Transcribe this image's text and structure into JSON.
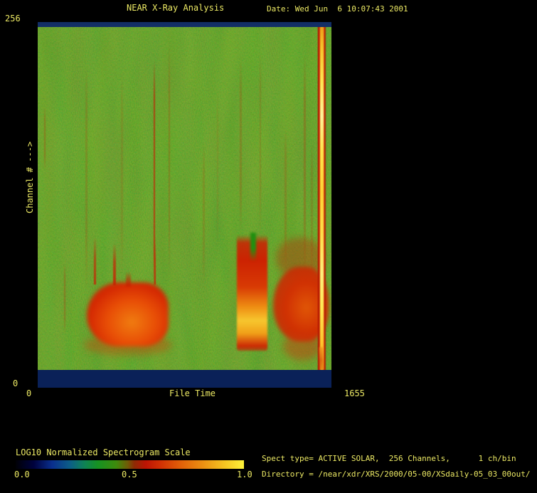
{
  "window": {
    "bg": "#000000",
    "text_color": "#ece964"
  },
  "header": {
    "title": "NEAR X-Ray Analysis",
    "date_label": "Date: Wed Jun  6 10:07:43 2001"
  },
  "plot": {
    "y_axis": {
      "top_label": "256",
      "bottom_label": "0",
      "axis_label": "Channel # --->"
    },
    "x_axis": {
      "left_label": "0",
      "center_label": "File Time",
      "right_label": "1655"
    }
  },
  "colorbar": {
    "title": "LOG10 Normalized Spectrogram Scale",
    "ticks": [
      "0.0",
      "0.5",
      "1.0"
    ],
    "gradient": [
      "#010106 0%",
      "#00023e 8%",
      "#0a2f8e 16%",
      "#0c5f86 24%",
      "#0e8256 30%",
      "#169222 36%",
      "#3d8c0c 44%",
      "#6f5c06 49%",
      "#8f2a04 52%",
      "#bc1404 57%",
      "#d02e04 63%",
      "#e05e08 72%",
      "#eb9012 82%",
      "#f6c822 92%",
      "#fdf23a 100%"
    ]
  },
  "info": {
    "spect_type": "Spect type= ACTIVE SOLAR,  256 Channels,      1 ch/bin",
    "directory": "Directory = /near/xdr/XRS/2000/05-00/XSdaily-05_03_00out/"
  },
  "chart_data": {
    "type": "heatmap",
    "title": "NEAR X-Ray Analysis",
    "xlabel": "File Time",
    "xlim": [
      0,
      1655
    ],
    "ylabel": "Channel #",
    "ylim": [
      0,
      256
    ],
    "scale": {
      "label": "LOG10 Normalized Spectrogram Scale",
      "range": [
        0.0,
        1.0
      ]
    },
    "background_level": 0.45,
    "features": [
      {
        "label": "quiet-background",
        "time_range": [
          0,
          1655
        ],
        "channel_range": [
          13,
          251
        ],
        "level": 0.45,
        "description": "mottled green background noise"
      },
      {
        "label": "top-band",
        "time_range": [
          0,
          1655
        ],
        "channel_range": [
          252,
          256
        ],
        "level": 0.05,
        "description": "dark navy band at top edge"
      },
      {
        "label": "bottom-band",
        "time_range": [
          0,
          1655
        ],
        "channel_range": [
          0,
          12
        ],
        "level": 0.05,
        "description": "dark navy band at bottom edge"
      },
      {
        "label": "solar-event-1",
        "time_range": [
          277,
          737
        ],
        "channel_range": [
          29,
          74
        ],
        "level": 0.72,
        "description": "broad red emission blob with orange core; narrow spikes reach channel ~106 at t=317, 429, 657"
      },
      {
        "label": "solar-event-2",
        "time_range": [
          1122,
          1294
        ],
        "channel_range": [
          26,
          107
        ],
        "level": 0.85,
        "description": "columnar red event with bright orange-yellow core at channels 29-54"
      },
      {
        "label": "solar-event-3",
        "time_range": [
          1326,
          1639
        ],
        "channel_range": [
          32,
          82
        ],
        "level": 0.7,
        "description": "red emission region merging into saturated column"
      },
      {
        "label": "saturated-column",
        "time_range": [
          1583,
          1627
        ],
        "channel_range": [
          0,
          250
        ],
        "level": 1.0,
        "description": "full-height saturated yellow stripe"
      },
      {
        "label": "faint-vertical-streaks",
        "times": [
          36,
          148,
          268,
          469,
          653,
          737,
          929,
          1010,
          1138,
          1250,
          1390,
          1498,
          1538
        ],
        "level": 0.55,
        "description": "thin reddish vertical streaks over background"
      }
    ],
    "render": [
      {
        "name": "streak",
        "style": {
          "left": "2.2%",
          "top": "23.2%",
          "width": "0.5%",
          "height": "17.5%",
          "opacity": "0.5",
          "background": "linear-gradient(to bottom, rgba(175,45,5,0) 0%, rgba(180,42,5,0.6) 20%, rgba(185,40,5,0.6) 75%, rgba(175,45,5,0) 100%)",
          "filter": "blur(0.6px)"
        }
      },
      {
        "name": "streak",
        "style": {
          "left": "9.0%",
          "top": "65.9%",
          "width": "0.5%",
          "height": "19.5%",
          "opacity": "0.5",
          "background": "linear-gradient(to bottom, rgba(175,45,5,0) 0%, rgba(180,42,5,0.6) 20%, rgba(185,40,5,0.6) 75%, rgba(175,45,5,0) 100%)",
          "filter": "blur(0.6px)"
        }
      },
      {
        "name": "streak",
        "style": {
          "left": "16.2%",
          "top": "11.5%",
          "width": "0.7%",
          "height": "62.3%",
          "opacity": "0.3",
          "background": "linear-gradient(to bottom, rgba(175,45,5,0) 0%, rgba(180,42,5,0.6) 20%, rgba(185,40,5,0.6) 75%, rgba(175,45,5,0) 100%)",
          "filter": "blur(0.6px)"
        }
      },
      {
        "name": "streak",
        "style": {
          "left": "28.3%",
          "top": "13.4%",
          "width": "0.7%",
          "height": "54.5%",
          "opacity": "0.22",
          "background": "linear-gradient(to bottom, rgba(175,45,5,0) 0%, rgba(180,42,5,0.6) 20%, rgba(185,40,5,0.6) 75%, rgba(175,45,5,0) 100%)",
          "filter": "blur(0.6px)"
        }
      },
      {
        "name": "streak",
        "style": {
          "left": "39.5%",
          "top": "10.5%",
          "width": "0.5%",
          "height": "66.1%",
          "opacity": "0.85",
          "background": "linear-gradient(to bottom, rgba(196,28,2,0) 0%, rgba(196,28,2,0.8) 15%, rgba(200,30,2,0.85) 80%, rgba(196,28,2,0) 100%)",
          "filter": "blur(0.5px)"
        }
      },
      {
        "name": "streak",
        "style": {
          "left": "44.6%",
          "top": "5.6%",
          "width": "0.5%",
          "height": "64.2%",
          "opacity": "0.42",
          "background": "linear-gradient(to bottom, rgba(175,45,5,0) 0%, rgba(180,42,5,0.6) 20%, rgba(185,40,5,0.6) 75%, rgba(175,45,5,0) 100%)",
          "filter": "blur(0.6px)"
        }
      },
      {
        "name": "streak",
        "style": {
          "left": "56.2%",
          "top": "32.9%",
          "width": "0.6%",
          "height": "38.9%",
          "opacity": "0.25",
          "background": "linear-gradient(to bottom, rgba(175,45,5,0) 0%, rgba(180,42,5,0.6) 20%, rgba(185,40,5,0.6) 75%, rgba(175,45,5,0) 100%)",
          "filter": "blur(0.6px)"
        }
      },
      {
        "name": "streak",
        "style": {
          "left": "61.0%",
          "top": "17.3%",
          "width": "0.6%",
          "height": "44.7%",
          "opacity": "0.18",
          "background": "linear-gradient(to bottom, rgba(175,45,5,0) 0%, rgba(180,42,5,0.6) 20%, rgba(185,40,5,0.6) 75%, rgba(175,45,5,0) 100%)",
          "filter": "blur(0.6px)"
        }
      },
      {
        "name": "streak",
        "style": {
          "left": "68.8%",
          "top": "9.5%",
          "width": "0.6%",
          "height": "48.6%",
          "opacity": "0.35",
          "background": "linear-gradient(to bottom, rgba(175,45,5,0) 0%, rgba(180,42,5,0.6) 20%, rgba(185,40,5,0.6) 75%, rgba(175,45,5,0) 100%)",
          "filter": "blur(0.6px)"
        }
      },
      {
        "name": "streak",
        "style": {
          "left": "75.5%",
          "top": "7.6%",
          "width": "0.6%",
          "height": "50.6%",
          "opacity": "0.3",
          "background": "linear-gradient(to bottom, rgba(175,45,5,0) 0%, rgba(180,42,5,0.6) 20%, rgba(185,40,5,0.6) 75%, rgba(175,45,5,0) 100%)",
          "filter": "blur(0.6px)"
        }
      },
      {
        "name": "streak",
        "style": {
          "left": "84.0%",
          "top": "29.0%",
          "width": "0.7%",
          "height": "38.9%",
          "opacity": "0.3",
          "background": "linear-gradient(to bottom, rgba(175,45,5,0) 0%, rgba(180,42,5,0.6) 20%, rgba(185,40,5,0.6) 75%, rgba(175,45,5,0) 100%)",
          "filter": "blur(0.6px)"
        }
      },
      {
        "name": "streak",
        "style": {
          "left": "90.6%",
          "top": "8.6%",
          "width": "0.6%",
          "height": "60.3%",
          "opacity": "0.45",
          "background": "linear-gradient(to bottom, rgba(175,45,5,0) 0%, rgba(180,42,5,0.6) 20%, rgba(185,40,5,0.6) 75%, rgba(175,45,5,0) 100%)",
          "filter": "blur(0.6px)"
        }
      },
      {
        "name": "streak",
        "style": {
          "left": "93.0%",
          "top": "32.9%",
          "width": "0.6%",
          "height": "37.0%",
          "opacity": "0.3",
          "background": "linear-gradient(to bottom, rgba(175,45,5,0) 0%, rgba(180,42,5,0.6) 20%, rgba(185,40,5,0.6) 75%, rgba(175,45,5,0) 100%)",
          "filter": "blur(0.6px)"
        }
      },
      {
        "name": "event1-fringe",
        "style": {
          "left": "15.7%",
          "top": "85.4%",
          "width": "30%",
          "height": "5.8%",
          "background": "rgba(195,75,12,0.45)",
          "borderRadius": "50%",
          "filter": "blur(5px)"
        }
      },
      {
        "name": "event1-blob",
        "style": {
          "left": "16.7%",
          "top": "71.2%",
          "width": "27.8%",
          "height": "17.5%",
          "background": "radial-gradient(ellipse at 55% 62%, #f07c10 0%, #e84e06 38%, #d42802 68%, rgba(195,42,4,0.85) 86%, rgba(165,60,10,0) 100%)",
          "borderRadius": "45% 35% 35% 45% / 60% 45% 40% 55%",
          "filter": "blur(3px)"
        }
      },
      {
        "name": "event1-spike",
        "style": {
          "left": "19.1%",
          "top": "58.8%",
          "width": "0.7%",
          "height": "13%",
          "opacity": "0.85",
          "background": "linear-gradient(to top, rgba(200,34,2,0.95) 0%, rgba(198,36,4,0.75) 55%, rgba(190,45,8,0) 100%)",
          "filter": "blur(0.5px)"
        }
      },
      {
        "name": "event1-spike",
        "style": {
          "left": "25.7%",
          "top": "60.5%",
          "width": "1.0%",
          "height": "11.5%",
          "opacity": "0.9",
          "background": "linear-gradient(to top, rgba(200,34,2,0.95) 0%, rgba(198,36,4,0.75) 55%, rgba(190,45,8,0) 100%)",
          "filter": "blur(0.5px)"
        }
      },
      {
        "name": "event1-spike",
        "style": {
          "left": "30.0%",
          "top": "68.3%",
          "width": "1.7%",
          "height": "4.0%",
          "opacity": "0.8",
          "background": "linear-gradient(to top, rgba(200,34,2,0.95) 0%, rgba(198,36,4,0.7) 55%, rgba(190,45,8,0) 100%)",
          "filter": "blur(1px)"
        }
      },
      {
        "name": "event1-spike",
        "style": {
          "left": "39.6%",
          "top": "58.8%",
          "width": "0.7%",
          "height": "13%",
          "opacity": "0.9",
          "background": "linear-gradient(to top, rgba(200,34,2,0.95) 0%, rgba(198,36,4,0.75) 55%, rgba(190,45,8,0) 100%)",
          "filter": "blur(0.5px)"
        }
      },
      {
        "name": "event2-column",
        "style": {
          "left": "67.8%",
          "top": "58.2%",
          "width": "10.4%",
          "height": "31.7%",
          "background": "linear-gradient(to bottom, rgba(204,32,2,0) 0%, rgba(204,32,2,0.85) 7%, #cc2202 22%, #d83a04 45%, #ee8c12 62%, #f7c62e 74%, #f0a018 85%, #cc2a04 96%, rgba(190,40,6,0.6) 100%)",
          "borderRadius": "3px",
          "filter": "blur(1.2px)"
        }
      },
      {
        "name": "event2-notch",
        "style": {
          "left": "72.3%",
          "top": "57.5%",
          "width": "2.0%",
          "height": "7.8%",
          "background": "linear-gradient(to bottom, #218f10 55%, rgba(33,143,16,0) 100%)",
          "filter": "blur(1.5px)"
        }
      },
      {
        "name": "event3-upper",
        "style": {
          "left": "81.0%",
          "top": "59.0%",
          "width": "16.5%",
          "height": "11.0%",
          "background": "rgba(185,42,6,0.4)",
          "borderRadius": "50%",
          "filter": "blur(5px)"
        }
      },
      {
        "name": "event3-blob",
        "style": {
          "left": "80.1%",
          "top": "66.9%",
          "width": "18.9%",
          "height": "20.4%",
          "background": "radial-gradient(ellipse at 60% 55%, #e05606 0%, #d03003 45%, rgba(200,40,4,0.85) 75%, rgba(170,50,8,0) 100%)",
          "borderRadius": "50% 40% 40% 50% / 55% 50% 45% 50%",
          "filter": "blur(3px)"
        }
      },
      {
        "name": "event3-lower",
        "style": {
          "left": "83.5%",
          "top": "85.0%",
          "width": "13.0%",
          "height": "7.5%",
          "background": "rgba(200,55,8,0.45)",
          "borderRadius": "50%",
          "filter": "blur(5px)"
        }
      },
      {
        "name": "saturated-stripe",
        "style": {
          "left": "95.2%",
          "top": "1.4%",
          "width": "3.1%",
          "height": "93.7%",
          "background": "linear-gradient(to right, rgba(150,25,2,0) 0%, rgba(178,26,2,0.9) 10%, #c42404 24%, #e06008 38%, #f5b824 50%, #e06008 64%, #bc2204 80%, rgba(160,32,6,0.55) 92%, rgba(150,30,6,0) 100%)"
        }
      },
      {
        "name": "saturated-stripe-core",
        "style": {
          "left": "96.1%",
          "top": "1.4%",
          "width": "1.3%",
          "height": "93.7%",
          "background": "linear-gradient(to bottom, #eda01a 0%, #f7c42c 6%, #ffe754 16%, #fff49c 26%, #ffe64e 36%, #ffd436 48%, #ffdf4a 60%, #fff07e 72%, #ffe954 82%, #ffc62e 92%, #ef9c1a 100%)",
          "filter": "blur(0.7px)"
        }
      },
      {
        "name": "saturated-stripe-tail",
        "style": {
          "left": "96.0%",
          "top": "89.0%",
          "width": "1.2%",
          "height": "6.0%",
          "background": "linear-gradient(to bottom, rgba(240,150,30,0.85) 0%, rgba(205,70,10,0.65) 60%, rgba(190,60,10,0.25) 100%)",
          "filter": "blur(1px)"
        }
      },
      {
        "name": "band-top",
        "style": {
          "left": "0%",
          "top": "0%",
          "width": "100%",
          "height": "1.4%",
          "background": "#122e66"
        }
      },
      {
        "name": "band-bottom",
        "style": {
          "left": "0%",
          "top": "95.1%",
          "width": "100%",
          "height": "4.9%",
          "background": "#0a2158"
        }
      }
    ]
  }
}
